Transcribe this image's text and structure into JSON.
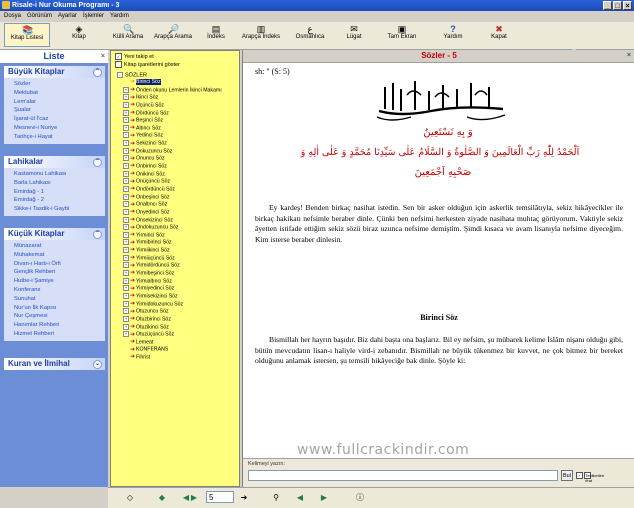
{
  "window": {
    "title": "Risale-i Nur Okuma Programı - 3",
    "buttons": [
      "_",
      "□",
      "×"
    ]
  },
  "menu": [
    "Dosya",
    "Görünüm",
    "Ayarlar",
    "İşlemler",
    "Yardım"
  ],
  "toolbar": [
    {
      "label": "Kitap Listesi",
      "icon": "book-list-icon",
      "glyph": "📚"
    },
    {
      "label": "Kitap",
      "icon": "book-icon",
      "glyph": "◈"
    },
    {
      "label": "Külli Arama",
      "icon": "search-all-icon",
      "glyph": "🔍"
    },
    {
      "label": "Arapça Arama",
      "icon": "arabic-search-icon",
      "glyph": "🔎"
    },
    {
      "label": "İndeks",
      "icon": "index-icon",
      "glyph": "▤"
    },
    {
      "label": "Arapça İndeks",
      "icon": "arabic-index-icon",
      "glyph": "▥"
    },
    {
      "label": "Osmanlıca",
      "icon": "ottoman-icon",
      "glyph": "ع"
    },
    {
      "label": "Lügat",
      "icon": "dictionary-icon",
      "glyph": "✉"
    },
    {
      "label": "Tam Ekran",
      "icon": "fullscreen-icon",
      "glyph": "▣"
    },
    {
      "label": "Yardım",
      "icon": "help-icon",
      "glyph": "?"
    },
    {
      "label": "Kapat",
      "icon": "close-app-icon",
      "glyph": "✖"
    }
  ],
  "left": {
    "header": "Liste",
    "groups": [
      {
        "title": "Büyük Kitaplar",
        "items": [
          "Sözler",
          "Mektubat",
          "Lem'alar",
          "Şualar",
          "İşarat-ül İ'caz",
          "Mesnevi-i Nuriye",
          "Tarihçe-i Hayat"
        ]
      },
      {
        "title": "Lahikalar",
        "items": [
          "Kastamonu Lahikası",
          "Barla Lahikası",
          "Emirdağ - 1",
          "Emirdağ - 2",
          "Sikke-i Tasdik-i Gaybi"
        ]
      },
      {
        "title": "Küçük Kitaplar",
        "items": [
          "Münazarat",
          "Muhakemat",
          "Divan-ı Harb-i Örfi",
          "Gençlik Rehberi",
          "Hutbe-i Şamiye",
          "Konferans",
          "Sunuhat",
          "Nur'un İlk Kapısı",
          "Nur Çeşmesi",
          "Hanımlar Rehberi",
          "Hizmet Rehberi"
        ]
      },
      {
        "title": "Kuran ve İlmihal",
        "items": []
      }
    ]
  },
  "tree": {
    "options": [
      "Yeni takip et",
      "Kitap işaretlerini göster"
    ],
    "root": "SÖZLER",
    "items": [
      "Birinci Söz",
      "Önden okunu Lemlerin İkinci Makamı",
      "İkinci Söz",
      "Üçüncü Söz",
      "Dördüncü Söz",
      "Beşinci Söz",
      "Altıncı Söz",
      "Yedinci Söz",
      "Sekizinci Söz",
      "Dokuzuncu Söz",
      "Onuncu Söz",
      "Onbirinci Söz",
      "Onikinci Söz",
      "Onüçüncü Söz",
      "Ondördüncü Söz",
      "Onbeşinci Söz",
      "Onaltıncı Söz",
      "Onyedinci Söz",
      "Onsekizinci Söz",
      "Ondokuzuncu Söz",
      "Yirminci Söz",
      "Yirmibirinci Söz",
      "Yirmiikinci Söz",
      "Yirmiüçüncü Söz",
      "Yirmidördüncü Söz",
      "Yirmibeşinci Söz",
      "Yirmialtıncı Söz",
      "Yirmiyedinci Söz",
      "Yirmisekizinci Söz",
      "Yirmidokuzuncu Söz",
      "Otuzuncu Söz",
      "Otuzbirinci Söz",
      "Otuzikinci Söz",
      "Otuzüçüncü Söz",
      "Lemeat",
      "KONFERANS",
      "Fihrist"
    ]
  },
  "content": {
    "header": "Sözler - 5",
    "reference": "sh: \" (S: 5)",
    "arabic1": "وَ بِهِ نَسْتَعِينُ",
    "arabic2": "اَلْحَمْدُ لِلّٰهِ رَبِّ الْعَالَمِينَ وَ الصَّلٰوةُ وَ السَّلَامُ عَلٰى سَيِّدِنَا مُحَمَّدٍ وَ عَلٰى اٰلِهِ وَ",
    "arabic3": "صَحْبِهِ اَجْمَعِينَ",
    "p1": "Ey kardeş! Benden birkaç nasihat istedin. Sen bir asker olduğun için askerlik temsilâtıyla, sekiz hikâyecikler ile birkaç hakikatı nefsimle beraber dinle. Çünki ben nefsimi herkesten ziyade nasihata muhtaç görüyorum. Vaktiyle sekiz âyetten istifade ettiğim sekiz sözü biraz uzunca nefsime demiştim. Şimdi kısaca ve avam lisanıyla nefsime diyeceğim. Kim isterse beraber dinlesin.",
    "section": "Birinci Söz",
    "p2": "Bismillah her hayrın başıdır. Biz dahi başta ona başlarız. Bil ey nefsim, şu mübarek kelime İslâm nişanı olduğu gibi, bütün mevcudatın lisan-ı haliyle vird-i zebanıdır. Bismillah ne büyük tükenmez bir kuvvet, ne çok bitmez bir bereket olduğunu anlamak istersen, şu temsili hikâyeciğe bak dinle. Şöyle ki:"
  },
  "search": {
    "label": "Kelimeyi yazın:",
    "button": "Bul",
    "checkbox": "Tekliketleri ifrat"
  },
  "status": {
    "page": "5"
  },
  "watermark": "www.fullcrackindir.com"
}
